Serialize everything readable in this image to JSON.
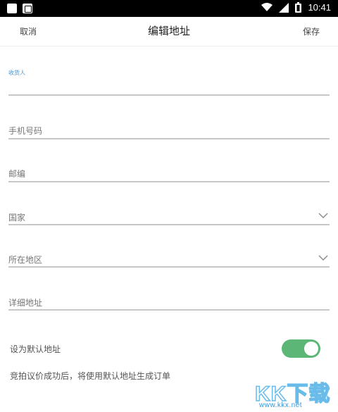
{
  "status_bar": {
    "time": "10:41",
    "icons": [
      "app-icon",
      "image-icon",
      "wifi-icon",
      "signal-icon",
      "battery-icon"
    ]
  },
  "nav": {
    "cancel": "取消",
    "title": "编辑地址",
    "save": "保存"
  },
  "form": {
    "recipient_label": "收货人",
    "phone_label": "手机号码",
    "zip_label": "邮编",
    "country_label": "国家",
    "region_label": "所在地区",
    "address_label": "详细地址"
  },
  "default_address": {
    "label": "设为默认地址",
    "enabled": true,
    "note": "竞拍议价成功后，将使用默认地址生成订单"
  },
  "watermark": {
    "brand": "KK下载",
    "url": "www.kkx.net"
  },
  "colors": {
    "toggle_on": "#5cb777",
    "focus_label": "#4a90c8",
    "watermark": "#4fb0e6"
  }
}
